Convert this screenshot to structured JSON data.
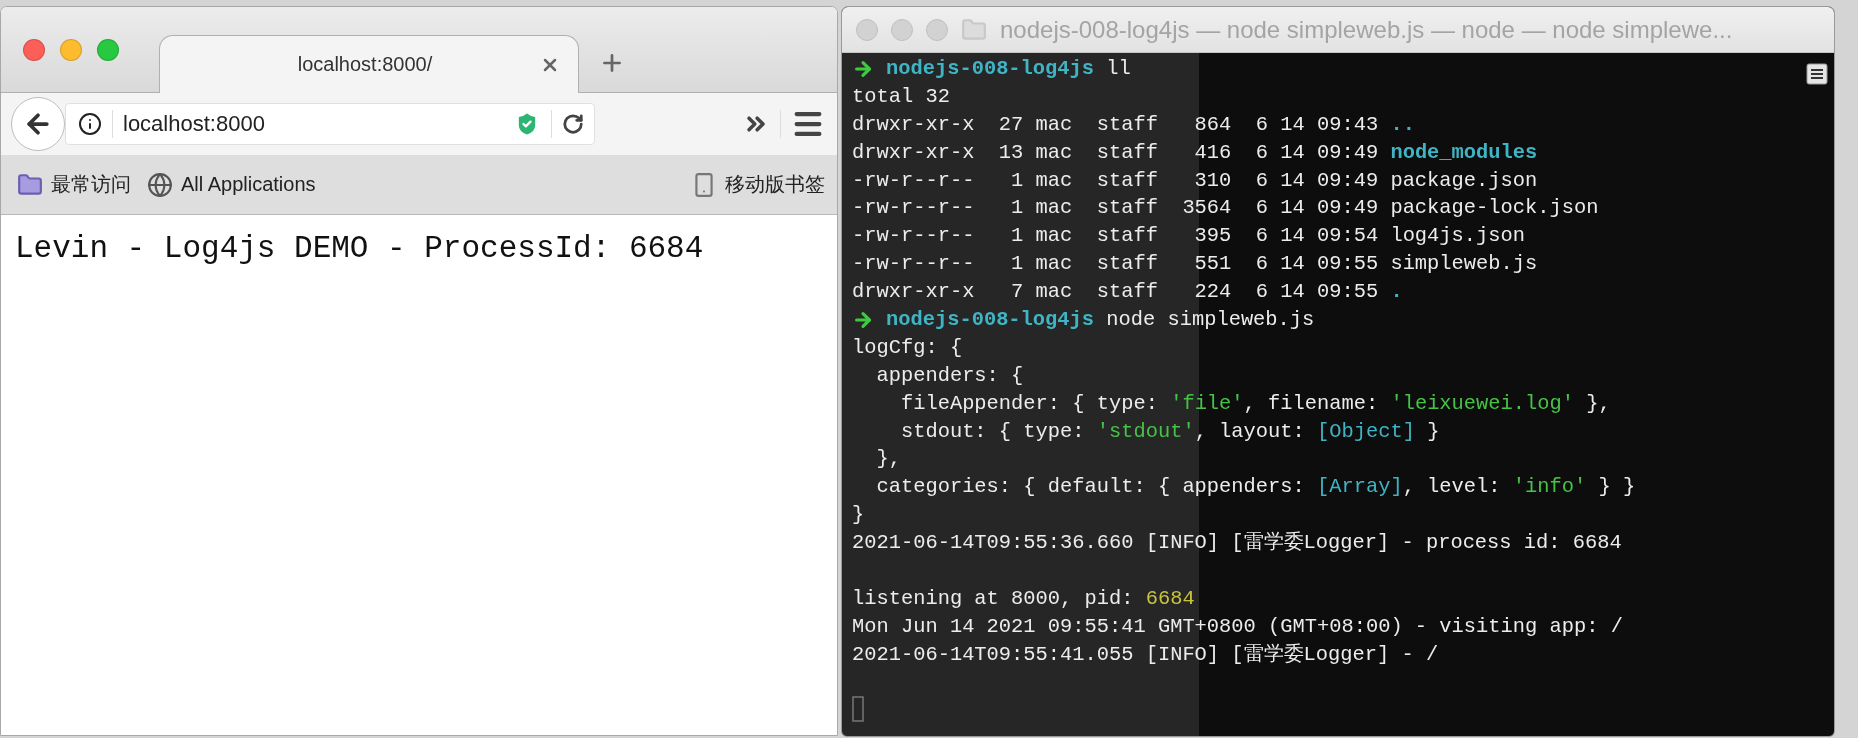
{
  "browser": {
    "tab": {
      "title": "localhost:8000/"
    },
    "address": {
      "value": "localhost:8000"
    },
    "bookmarks": [
      {
        "kind": "folder",
        "label": "最常访问"
      },
      {
        "kind": "globe",
        "label": "All Applications"
      }
    ],
    "mobile_bookmarks": "移动版书签",
    "page_text": "Levin - Log4js DEMO - ProcessId: 6684"
  },
  "terminal": {
    "title": "nodejs-008-log4js — node simpleweb.js — node — node simplewe...",
    "lines": [
      {
        "kind": "prompt",
        "dir": "nodejs-008-log4js",
        "command": "ll"
      },
      {
        "kind": "output",
        "segments": [
          {
            "kind": "plain",
            "text": "total 32"
          }
        ]
      },
      {
        "kind": "output",
        "segments": [
          {
            "kind": "plain",
            "text": "drwxr-xr-x  27 mac  staff   864  6 14 09:43 "
          },
          {
            "kind": "dir",
            "text": ".."
          }
        ]
      },
      {
        "kind": "output",
        "segments": [
          {
            "kind": "plain",
            "text": "drwxr-xr-x  13 mac  staff   416  6 14 09:49 "
          },
          {
            "kind": "dir",
            "text": "node_modules"
          }
        ]
      },
      {
        "kind": "output",
        "segments": [
          {
            "kind": "plain",
            "text": "-rw-r--r--   1 mac  staff   310  6 14 09:49 package.json"
          }
        ]
      },
      {
        "kind": "output",
        "segments": [
          {
            "kind": "plain",
            "text": "-rw-r--r--   1 mac  staff  3564  6 14 09:49 package-lock.json"
          }
        ]
      },
      {
        "kind": "output",
        "segments": [
          {
            "kind": "plain",
            "text": "-rw-r--r--   1 mac  staff   395  6 14 09:54 log4js.json"
          }
        ]
      },
      {
        "kind": "output",
        "segments": [
          {
            "kind": "plain",
            "text": "-rw-r--r--   1 mac  staff   551  6 14 09:55 simpleweb.js"
          }
        ]
      },
      {
        "kind": "output",
        "segments": [
          {
            "kind": "plain",
            "text": "drwxr-xr-x   7 mac  staff   224  6 14 09:55 "
          },
          {
            "kind": "dir",
            "text": "."
          }
        ]
      },
      {
        "kind": "prompt",
        "dir": "nodejs-008-log4js",
        "command": "node simpleweb.js"
      },
      {
        "kind": "output",
        "segments": [
          {
            "kind": "plain",
            "text": "logCfg: {"
          }
        ]
      },
      {
        "kind": "output",
        "segments": [
          {
            "kind": "plain",
            "text": "  appenders: {"
          }
        ]
      },
      {
        "kind": "output",
        "segments": [
          {
            "kind": "plain",
            "text": "    fileAppender: { type: "
          },
          {
            "kind": "string",
            "text": "'file'"
          },
          {
            "kind": "plain",
            "text": ", filename: "
          },
          {
            "kind": "string",
            "text": "'leixuewei.log'"
          },
          {
            "kind": "plain",
            "text": " },"
          }
        ]
      },
      {
        "kind": "output",
        "segments": [
          {
            "kind": "plain",
            "text": "    stdout: { type: "
          },
          {
            "kind": "string",
            "text": "'stdout'"
          },
          {
            "kind": "plain",
            "text": ", layout: "
          },
          {
            "kind": "special",
            "text": "[Object]"
          },
          {
            "kind": "plain",
            "text": " }"
          }
        ]
      },
      {
        "kind": "output",
        "segments": [
          {
            "kind": "plain",
            "text": "  },"
          }
        ]
      },
      {
        "kind": "output",
        "segments": [
          {
            "kind": "plain",
            "text": "  categories: { default: { appenders: "
          },
          {
            "kind": "special",
            "text": "[Array]"
          },
          {
            "kind": "plain",
            "text": ", level: "
          },
          {
            "kind": "string",
            "text": "'info'"
          },
          {
            "kind": "plain",
            "text": " } }"
          }
        ]
      },
      {
        "kind": "output",
        "segments": [
          {
            "kind": "plain",
            "text": "}"
          }
        ]
      },
      {
        "kind": "output",
        "segments": [
          {
            "kind": "plain",
            "text": "2021-06-14T09:55:36.660 [INFO] [雷学委Logger] - process id: 6684"
          }
        ]
      },
      {
        "kind": "blank"
      },
      {
        "kind": "output",
        "segments": [
          {
            "kind": "plain",
            "text": "listening at 8000, pid: "
          },
          {
            "kind": "number",
            "text": "6684"
          }
        ]
      },
      {
        "kind": "output",
        "segments": [
          {
            "kind": "plain",
            "text": "Mon Jun 14 2021 09:55:41 GMT+0800 (GMT+08:00) - visiting app: /"
          }
        ]
      },
      {
        "kind": "output",
        "segments": [
          {
            "kind": "plain",
            "text": "2021-06-14T09:55:41.055 [INFO] [雷学委Logger] - /"
          }
        ]
      },
      {
        "kind": "blank"
      },
      {
        "kind": "cursor"
      }
    ]
  }
}
